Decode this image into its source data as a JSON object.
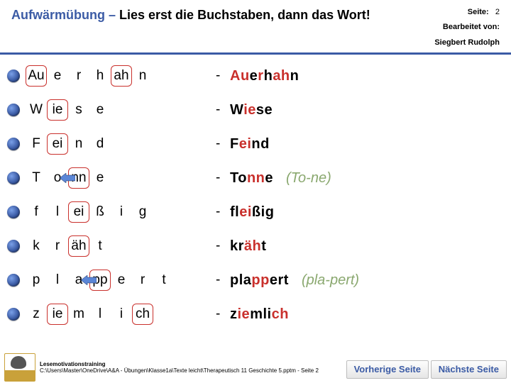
{
  "header": {
    "title_prefix": "Aufwärmübung",
    "title_sep": " – ",
    "title_rest": "Lies erst die Buchstaben, dann das Wort!",
    "page_label": "Seite:",
    "page_num": "2",
    "editor_label": "Bearbeitet von:",
    "editor_name": "Siegbert Rudolph"
  },
  "rows": [
    {
      "cells": [
        "Au",
        "e",
        "r",
        "h",
        "ah",
        "n",
        "",
        ""
      ],
      "boxed": [
        0,
        4
      ],
      "arrow": null,
      "dash": "-",
      "word_parts": [
        [
          "Au",
          1
        ],
        [
          "e",
          0
        ],
        [
          "r",
          1
        ],
        [
          "h",
          0
        ],
        [
          "ah",
          1
        ],
        [
          "n",
          0
        ]
      ],
      "hint": ""
    },
    {
      "cells": [
        "W",
        "ie",
        "s",
        "e",
        "",
        "",
        "",
        ""
      ],
      "boxed": [
        1
      ],
      "arrow": null,
      "dash": "-",
      "word_parts": [
        [
          "W",
          0
        ],
        [
          "ie",
          1
        ],
        [
          "s",
          0
        ],
        [
          "e",
          0
        ]
      ],
      "hint": ""
    },
    {
      "cells": [
        "F",
        "ei",
        "n",
        "d",
        "",
        "",
        "",
        ""
      ],
      "boxed": [
        1
      ],
      "arrow": null,
      "dash": "-",
      "word_parts": [
        [
          "F",
          0
        ],
        [
          "ei",
          1
        ],
        [
          "n",
          0
        ],
        [
          "d",
          0
        ]
      ],
      "hint": ""
    },
    {
      "cells": [
        "T",
        "o",
        "nn",
        "e",
        "",
        "",
        "",
        ""
      ],
      "boxed": [
        2
      ],
      "arrow": {
        "after": 1
      },
      "dash": "-",
      "word_parts": [
        [
          "T",
          0
        ],
        [
          "o",
          0
        ],
        [
          "nn",
          1
        ],
        [
          "e",
          0
        ]
      ],
      "hint": "(To-ne)"
    },
    {
      "cells": [
        "f",
        "l",
        "ei",
        "ß",
        "i",
        "g",
        "",
        ""
      ],
      "boxed": [
        2
      ],
      "arrow": null,
      "dash": "-",
      "word_parts": [
        [
          "fl",
          0
        ],
        [
          "ei",
          1
        ],
        [
          "ß",
          0
        ],
        [
          "i",
          0
        ],
        [
          "g",
          0
        ]
      ],
      "hint": ""
    },
    {
      "cells": [
        "k",
        "r",
        "äh",
        "t",
        "",
        "",
        "",
        ""
      ],
      "boxed": [
        2
      ],
      "arrow": null,
      "dash": "-",
      "word_parts": [
        [
          "kr",
          0
        ],
        [
          "äh",
          1
        ],
        [
          "t",
          0
        ]
      ],
      "hint": ""
    },
    {
      "cells": [
        "p",
        "l",
        "a",
        "pp",
        "e",
        "r",
        "t",
        ""
      ],
      "boxed": [
        3
      ],
      "arrow": {
        "after": 2
      },
      "dash": "-",
      "word_parts": [
        [
          "pla",
          0
        ],
        [
          "pp",
          1
        ],
        [
          "e",
          0
        ],
        [
          "r",
          0
        ],
        [
          "t",
          0
        ]
      ],
      "hint": "(pla-pert)"
    },
    {
      "cells": [
        "z",
        "ie",
        "m",
        "l",
        "i",
        "ch",
        "",
        ""
      ],
      "boxed": [
        1,
        5
      ],
      "arrow": null,
      "dash": "-",
      "word_parts": [
        [
          "z",
          0
        ],
        [
          "ie",
          1
        ],
        [
          "ml",
          0
        ],
        [
          "i",
          0
        ],
        [
          "ch",
          1
        ]
      ],
      "hint": ""
    }
  ],
  "footer": {
    "line1": "Lesemotivationstraining",
    "line2": "C:\\Users\\Master\\OneDrive\\A&A - Übungen\\Klasse1a\\Texte leicht\\Therapeutisch 11 Geschichte 5.pptm - Seite 2",
    "btn_prev": "Vorherige Seite",
    "btn_next": "Nächste Seite"
  }
}
